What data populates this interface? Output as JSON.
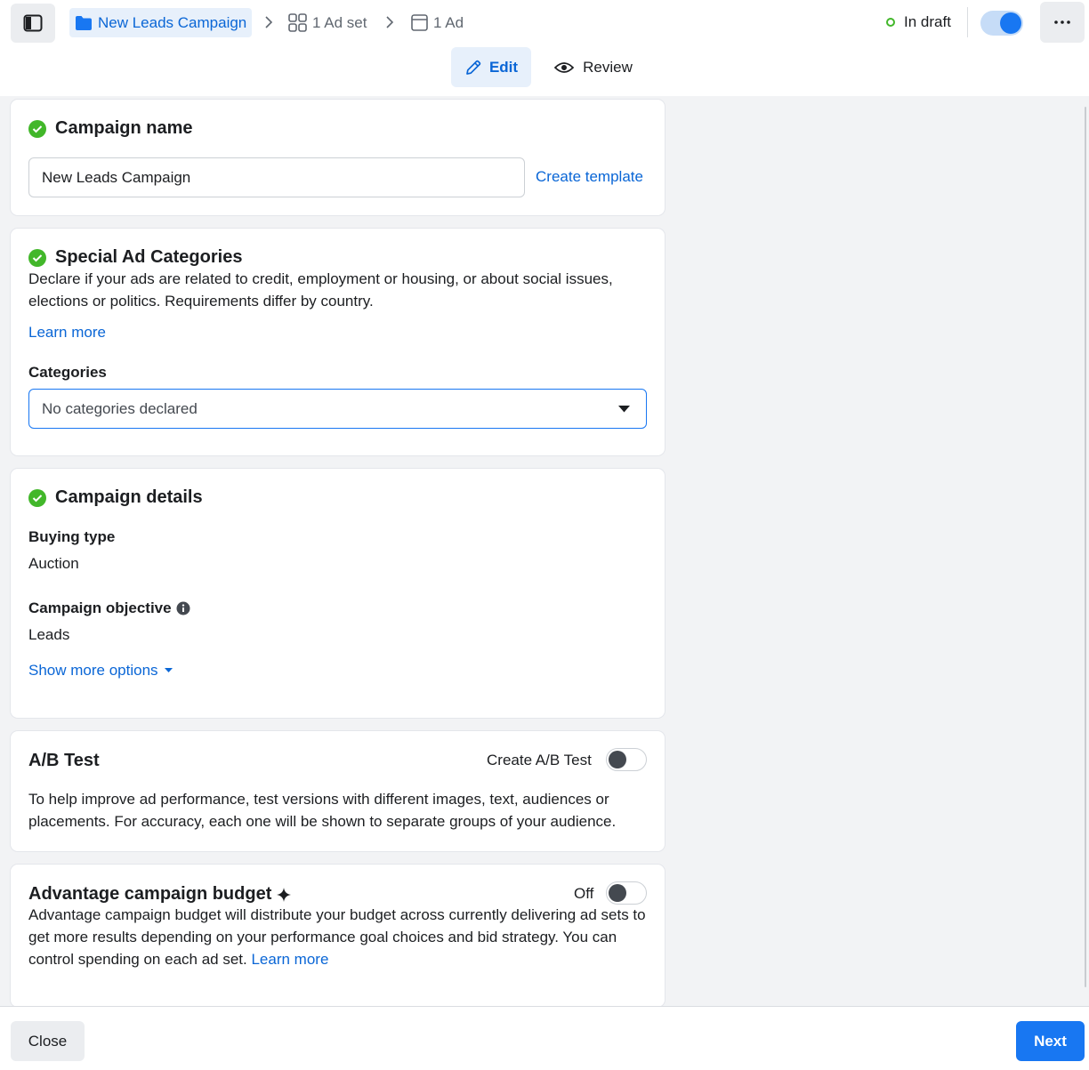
{
  "header": {
    "breadcrumbs": {
      "campaign": "New Leads Campaign",
      "ad_set": "1 Ad set",
      "ad": "1 Ad"
    },
    "status": "In draft",
    "tabs": {
      "edit": "Edit",
      "review": "Review"
    },
    "icons": {
      "sidebar": "sidebar-toggle-icon",
      "folder": "folder-icon",
      "grid": "grid-icon",
      "ad": "ad-window-icon",
      "more": "more-icon",
      "edit": "pencil-icon",
      "review": "eye-icon"
    },
    "colors": {
      "accent": "#1877f2",
      "status_dot": "#42b72a"
    }
  },
  "campaign_name": {
    "title": "Campaign name",
    "value": "New Leads Campaign",
    "create_template": "Create template"
  },
  "special_ad_categories": {
    "title": "Special Ad Categories",
    "description": "Declare if your ads are related to credit, employment or housing, or about social issues, elections or politics. Requirements differ by country.",
    "learn_more": "Learn more",
    "categories_label": "Categories",
    "categories_value": "No categories declared"
  },
  "campaign_details": {
    "title": "Campaign details",
    "buying_type_label": "Buying type",
    "buying_type_value": "Auction",
    "objective_label": "Campaign objective",
    "objective_value": "Leads",
    "show_more": "Show more options"
  },
  "ab_test": {
    "title": "A/B Test",
    "toggle_label": "Create A/B Test",
    "toggle_on": false,
    "description": "To help improve ad performance, test versions with different images, text, audiences or placements. For accuracy, each one will be shown to separate groups of your audience."
  },
  "advantage_budget": {
    "title": "Advantage campaign budget",
    "toggle_label": "Off",
    "toggle_on": false,
    "description": "Advantage campaign budget will distribute your budget across currently delivering ad sets to get more results depending on your performance goal choices and bid strategy. You can control spending on each ad set.",
    "learn_more": "Learn more"
  },
  "footer": {
    "close": "Close",
    "next": "Next"
  }
}
